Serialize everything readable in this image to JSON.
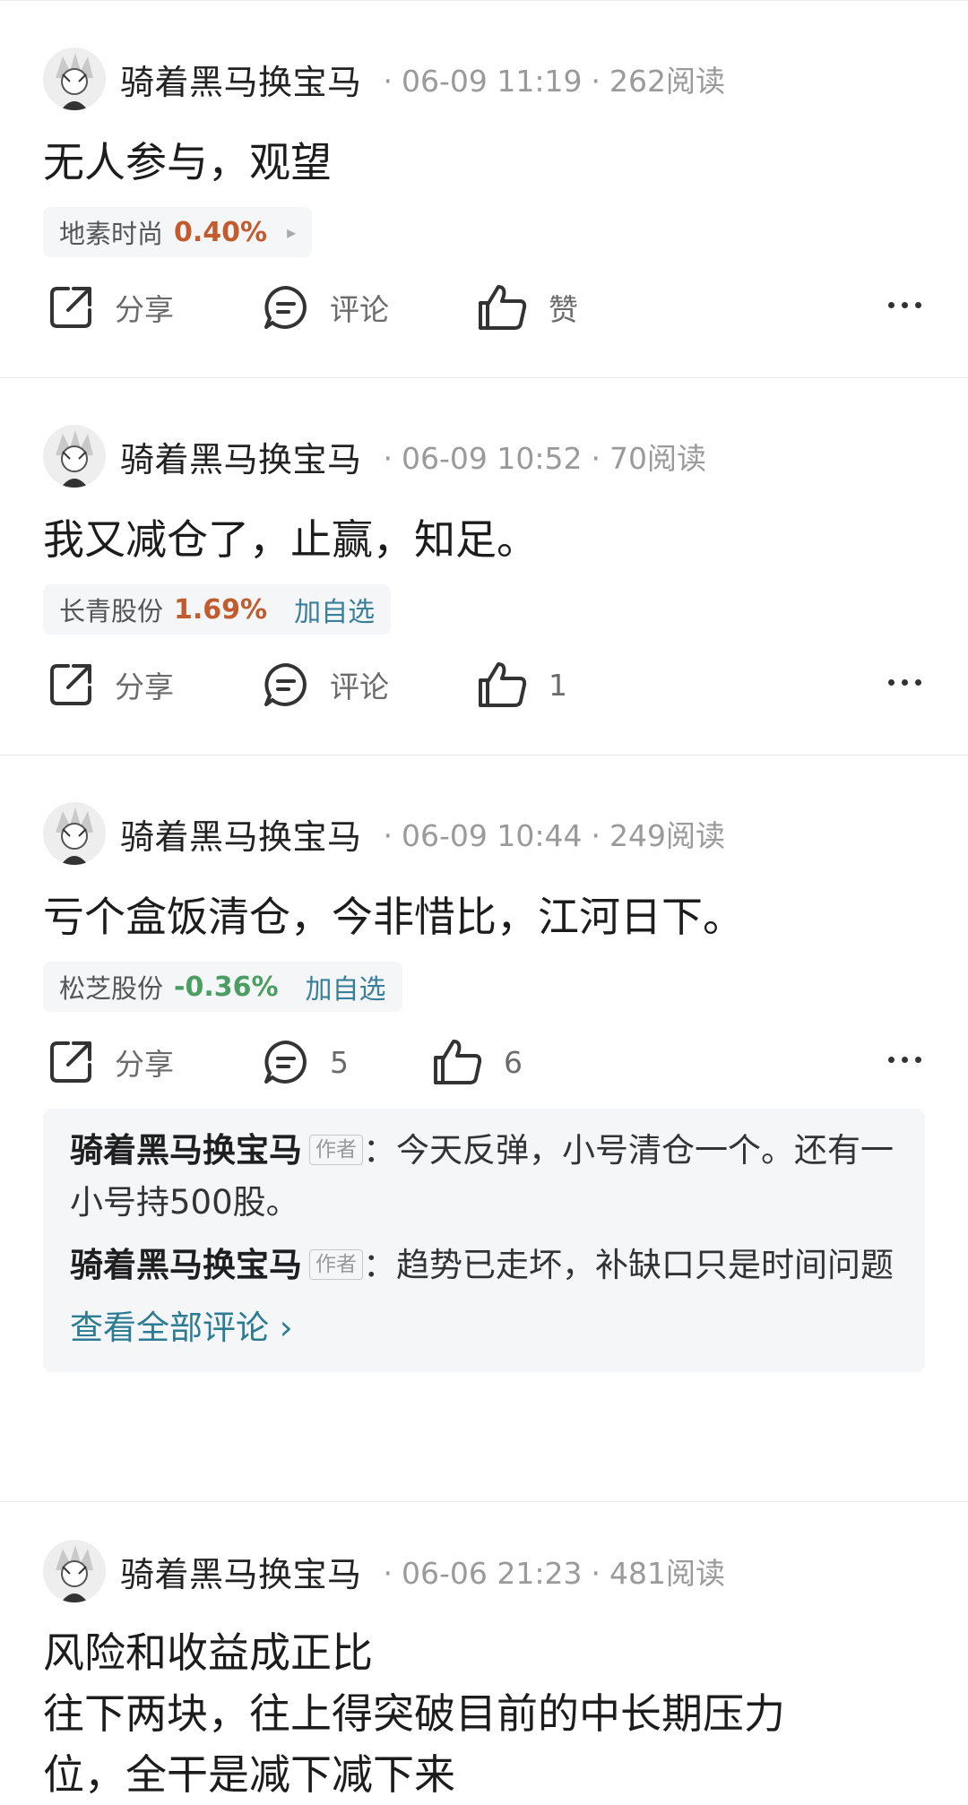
{
  "posts": [
    {
      "author": "骑着黑马换宝马",
      "date": "06-09 11:19",
      "reads": "262阅读",
      "content": "无人参与，观望",
      "stock": {
        "name": "地素时尚",
        "change": "0.40%",
        "arrow": "▸"
      },
      "actions": {
        "share": "分享",
        "comment": "评论",
        "like": "赞"
      }
    },
    {
      "author": "骑着黑马换宝马",
      "date": "06-09 10:52",
      "reads": "70阅读",
      "content": "我又减仓了，止赢，知足。",
      "stock": {
        "name": "长青股份",
        "change": "1.69%",
        "add": "加自选"
      },
      "actions": {
        "share": "分享",
        "comment": "评论",
        "like": "1"
      }
    },
    {
      "author": "骑着黑马换宝马",
      "date": "06-09 10:44",
      "reads": "249阅读",
      "content": "亏个盒饭清仓，今非惜比，江河日下。",
      "stock": {
        "name": "松芝股份",
        "change": "-0.36%",
        "add": "加自选"
      },
      "actions": {
        "share": "分享",
        "comment": "5",
        "like": "6"
      },
      "comments": [
        {
          "author": "骑着黑马换宝马",
          "badge": "作者",
          "text": "今天反弹，小号清仓一个。还有一小号持500股。"
        },
        {
          "author": "骑着黑马换宝马",
          "badge": "作者",
          "text": "趋势已走坏，补缺口只是时间问题"
        }
      ],
      "view_all": "查看全部评论 ›"
    },
    {
      "author": "骑着黑马换宝马",
      "date": "06-06 21:23",
      "reads": "481阅读",
      "content_lines": [
        "风险和收益成正比",
        "往下两块，往上得突破目前的中长期压力",
        "位，全干是减下减下来"
      ]
    }
  ],
  "meta_separator": "·",
  "colors": {
    "up": "#c25b2e",
    "down": "#4a9e62",
    "link": "#2b7b93"
  }
}
